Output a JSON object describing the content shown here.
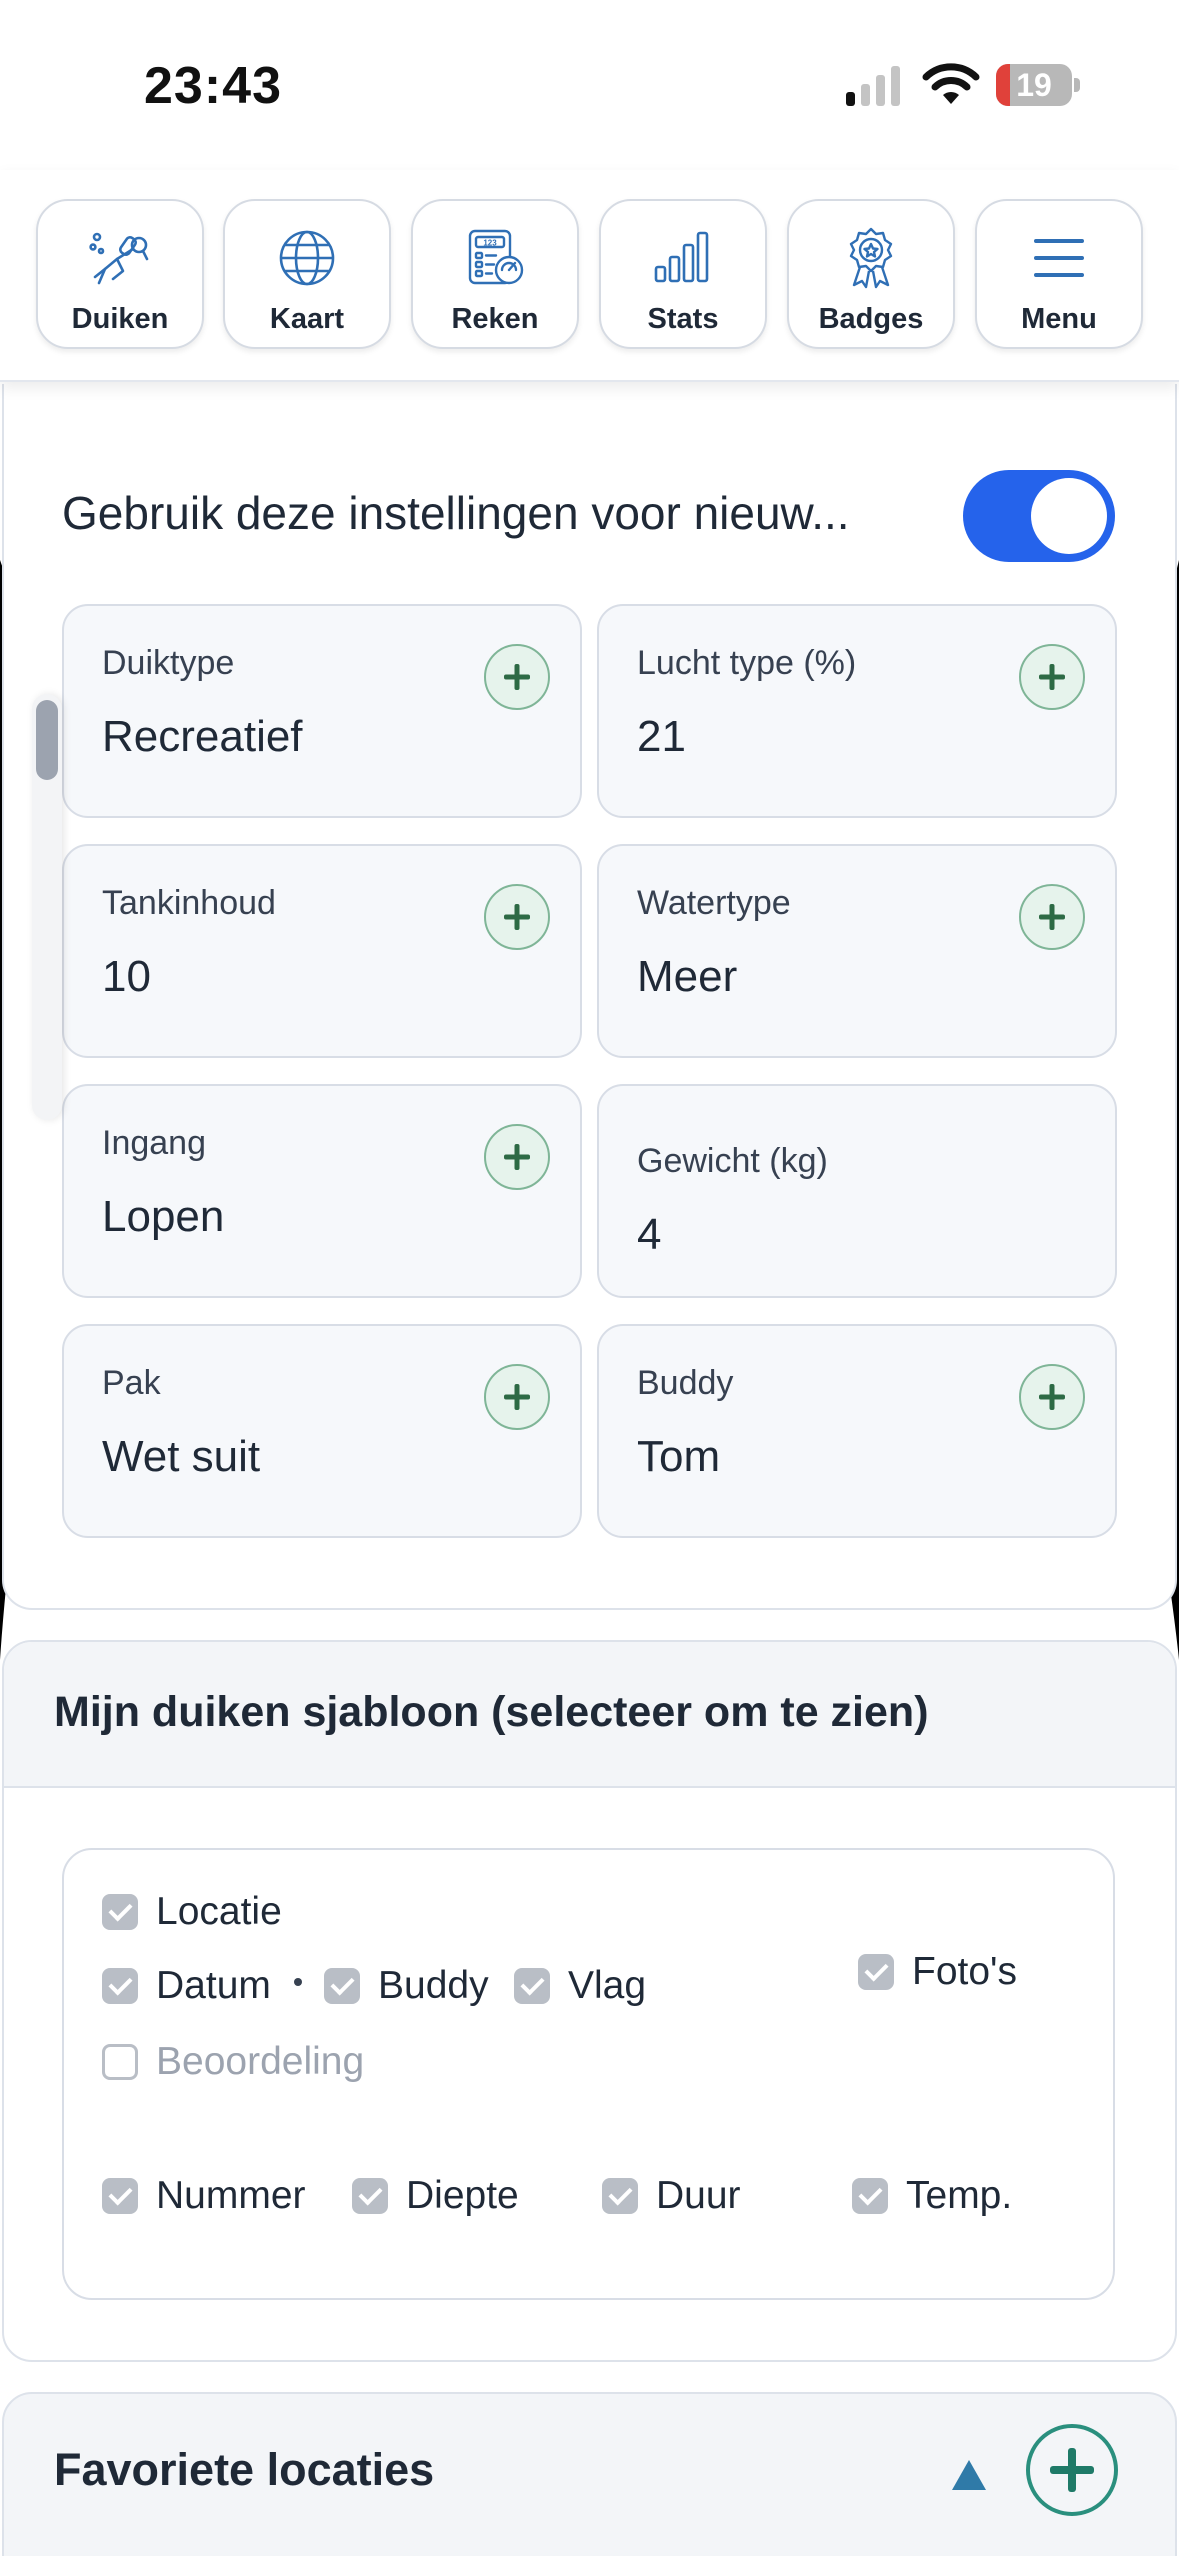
{
  "status_bar": {
    "time": "23:43",
    "battery_level": "19",
    "battery_color": "#e0413a"
  },
  "nav": {
    "items": [
      {
        "label": "Duiken",
        "icon": "diver-icon"
      },
      {
        "label": "Kaart",
        "icon": "globe-icon"
      },
      {
        "label": "Reken",
        "icon": "calculator-icon"
      },
      {
        "label": "Stats",
        "icon": "bar-chart-icon"
      },
      {
        "label": "Badges",
        "icon": "badge-icon"
      },
      {
        "label": "Menu",
        "icon": "hamburger-menu-icon"
      }
    ]
  },
  "settings": {
    "toggle_label": "Gebruik deze instellingen voor nieuw...",
    "toggle_on": true,
    "accent_color": "#2563eb",
    "fields": [
      {
        "label": "Duiktype",
        "value": "Recreatief"
      },
      {
        "label": "Lucht type (%)",
        "value": "21"
      },
      {
        "label": "Tankinhoud",
        "value": "10"
      },
      {
        "label": "Watertype",
        "value": "Meer"
      },
      {
        "label": "Ingang",
        "value": "Lopen"
      },
      {
        "label": "Gewicht (kg)",
        "value": "4"
      },
      {
        "label": "Pak",
        "value": "Wet suit"
      },
      {
        "label": "Buddy",
        "value": "Tom"
      }
    ]
  },
  "template": {
    "title": "Mijn duiken sjabloon (selecteer om te zien)",
    "options": [
      {
        "label": "Locatie",
        "checked": true
      },
      {
        "label": "Datum",
        "checked": true
      },
      {
        "label": "Buddy",
        "checked": true
      },
      {
        "label": "Vlag",
        "checked": true
      },
      {
        "label": "Foto's",
        "checked": true
      },
      {
        "label": "Beoordeling",
        "checked": false
      },
      {
        "label": "Nummer",
        "checked": true
      },
      {
        "label": "Diepte",
        "checked": true
      },
      {
        "label": "Duur",
        "checked": true
      },
      {
        "label": "Temp.",
        "checked": true
      }
    ]
  },
  "favorites": {
    "title": "Favoriete locaties"
  }
}
